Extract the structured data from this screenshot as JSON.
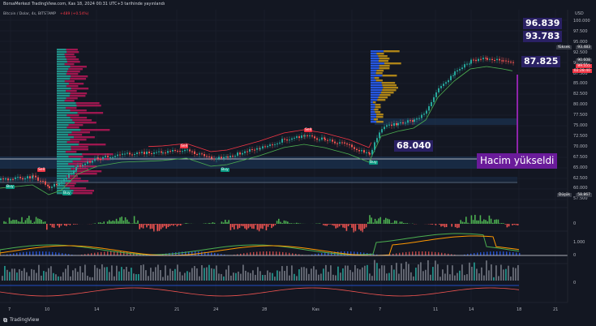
{
  "header": {
    "publisher_line": "BorsaMerkezi TradingView.com, Kas 18, 2024 00:31 UTC+3 tarihinde yayınlandı",
    "symbol_line": "Bitcoin / Dolar, 4s, BITSTAMP",
    "change": "+489 (+0.54%)"
  },
  "price_axis": {
    "currency": "USD",
    "ticks": [
      "100.000",
      "97.500",
      "95.000",
      "92.500",
      "90.000",
      "87.500",
      "85.000",
      "82.500",
      "80.000",
      "77.500",
      "75.000",
      "72.500",
      "70.000",
      "67.500",
      "65.000",
      "62.500",
      "60.000",
      "57.500"
    ],
    "tags": {
      "high_label": "Yüksek",
      "high_value": "93.483",
      "current_value": "90.608",
      "current_value2": "89.555",
      "countdown": "02:28:40",
      "low_label": "Düşük",
      "low_value": "58.867"
    }
  },
  "time_axis": [
    "7",
    "10",
    "14",
    "17",
    "21",
    "24",
    "28",
    "Kas",
    "4",
    "7",
    "11",
    "14",
    "18",
    "21"
  ],
  "annotations": {
    "level_1": "96.839",
    "level_2": "93.783",
    "level_3": "87.825",
    "level_4": "68.040",
    "volume_note": "Hacim yükseldi"
  },
  "signals": {
    "sell": "Sell",
    "buy": "Buy"
  },
  "indicator_values": {
    "ind1_zero": "0",
    "ind2_top": "1.000",
    "ind2_zero": "0",
    "ind3_zero": "0"
  },
  "footer": {
    "brand": "TradingView"
  },
  "colors": {
    "background": "#131722",
    "buy_green": "#089981",
    "sell_red": "#f23645",
    "callout": "#2a2164",
    "volume_note_bg": "#8e24aa"
  }
}
